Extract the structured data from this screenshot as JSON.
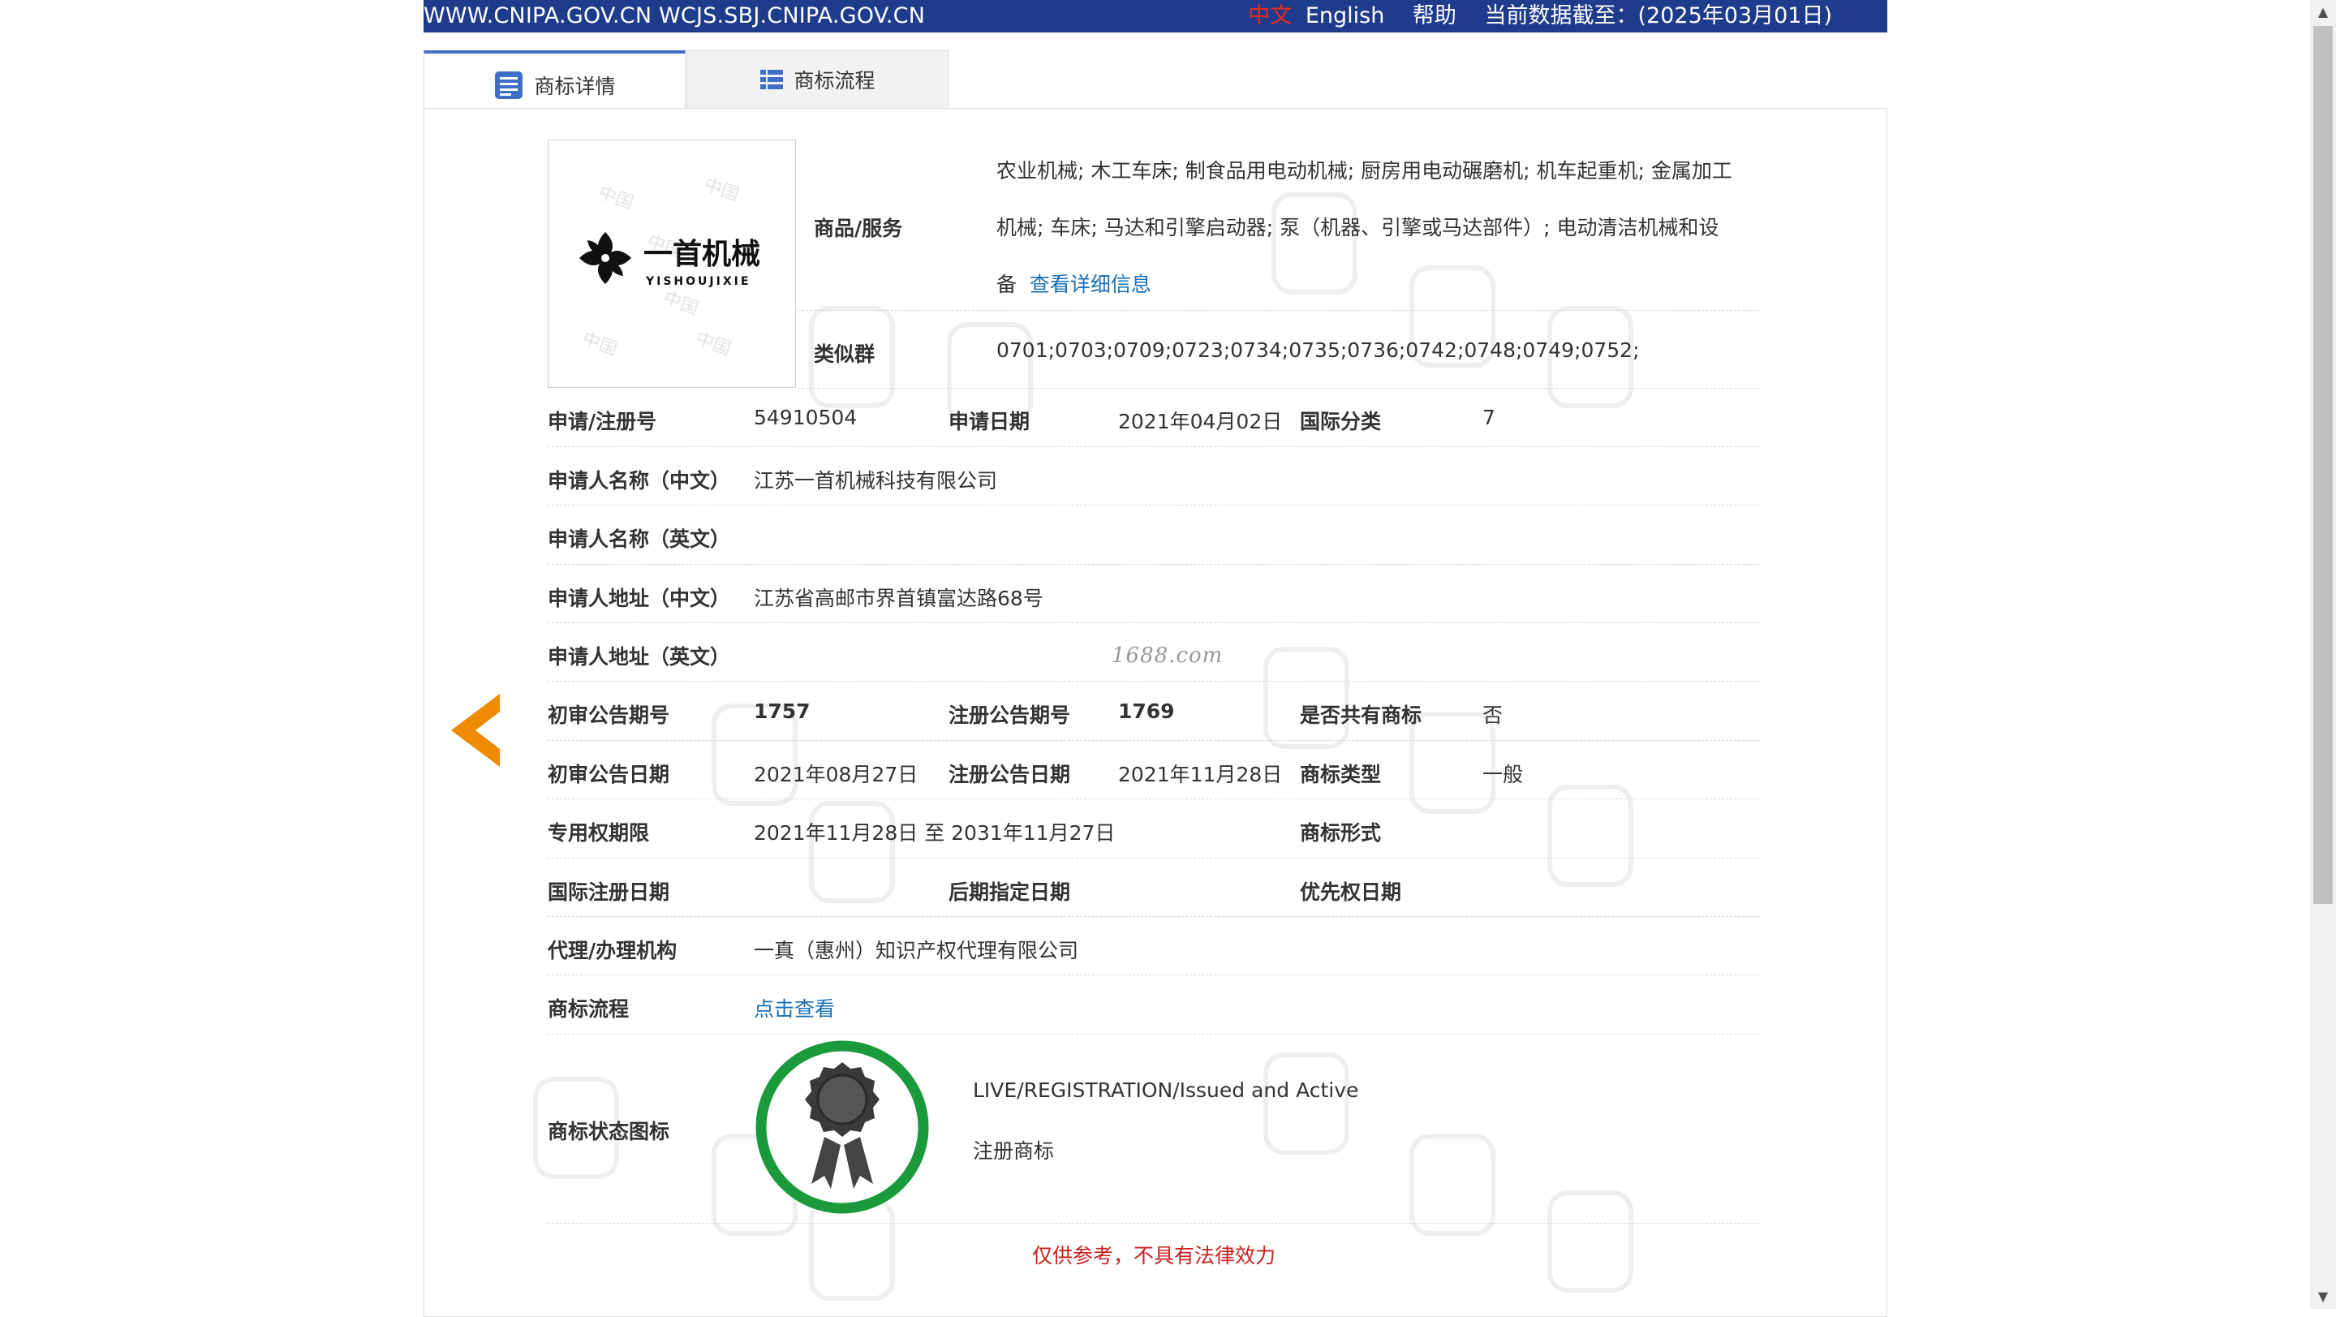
{
  "topbar": {
    "site": "WWW.CNIPA.GOV.CN WCJS.SBJ.CNIPA.GOV.CN",
    "lang_zh": "中文",
    "lang_en": "English",
    "help": "帮助",
    "data_date": "当前数据截至：(2025年03月01日)"
  },
  "tabs": {
    "detail": "商标详情",
    "flow": "商标流程"
  },
  "logo": {
    "text_cn": "一首机械",
    "text_en": "YISHOUJIXIE"
  },
  "goods": {
    "label": "商品/服务",
    "text": "农业机械; 木工车床; 制食品用电动机械; 厨房用电动碾磨机; 机车起重机; 金属加工机械; 车床; 马达和引擎启动器; 泵（机器、引擎或马达部件）; 电动清洁机械和设备",
    "more_link": "查看详细信息"
  },
  "similar_group": {
    "label": "类似群",
    "value": "0701;0703;0709;0723;0734;0735;0736;0742;0748;0749;0752;"
  },
  "fields": {
    "reg_no_label": "申请/注册号",
    "reg_no": "54910504",
    "apply_date_label": "申请日期",
    "apply_date": "2021年04月02日",
    "intl_class_label": "国际分类",
    "intl_class": "7",
    "applicant_cn_label": "申请人名称（中文）",
    "applicant_cn": "江苏一首机械科技有限公司",
    "applicant_en_label": "申请人名称（英文）",
    "address_cn_label": "申请人地址（中文）",
    "address_cn": "江苏省高邮市界首镇富达路68号",
    "address_en_label": "申请人地址（英文）",
    "prelim_no_label": "初审公告期号",
    "prelim_no": "1757",
    "reg_notice_no_label": "注册公告期号",
    "reg_notice_no": "1769",
    "shared_label": "是否共有商标",
    "shared": "否",
    "prelim_date_label": "初审公告日期",
    "prelim_date": "2021年08月27日",
    "reg_notice_date_label": "注册公告日期",
    "reg_notice_date": "2021年11月28日",
    "tm_type_label": "商标类型",
    "tm_type": "一般",
    "exclusive_label": "专用权期限",
    "exclusive": "2021年11月28日 至 2031年11月27日",
    "tm_form_label": "商标形式",
    "intl_reg_date_label": "国际注册日期",
    "later_date_label": "后期指定日期",
    "priority_date_label": "优先权日期",
    "agent_label": "代理/办理机构",
    "agent": "一真（惠州）知识产权代理有限公司",
    "flow_label": "商标流程",
    "flow_link": "点击查看",
    "status_label": "商标状态图标",
    "status_en": "LIVE/REGISTRATION/Issued and Active",
    "status_cn": "注册商标"
  },
  "watermark_site": "1688.com",
  "footer_note": "仅供参考，不具有法律效力",
  "colors": {
    "topbar": "#1f3b8c",
    "accent": "#3f6fc4",
    "link": "#1a6fb7",
    "arrow": "#f08a00",
    "seal_green": "#1a9a3a",
    "warning": "#cc1f1f"
  }
}
